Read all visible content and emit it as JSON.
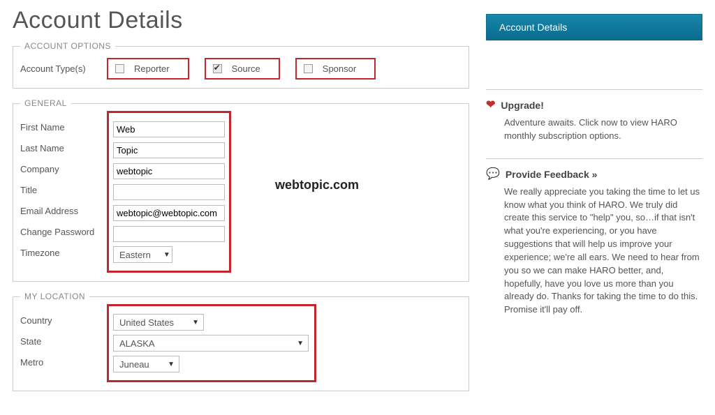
{
  "title": "Account Details",
  "sidebar_tab": "Account Details",
  "account_options": {
    "legend": "ACCOUNT OPTIONS",
    "label": "Account Type(s)",
    "types": [
      {
        "label": "Reporter",
        "checked": false
      },
      {
        "label": "Source",
        "checked": true
      },
      {
        "label": "Sponsor",
        "checked": false
      }
    ]
  },
  "general": {
    "legend": "GENERAL",
    "first_name_label": "First Name",
    "first_name": "Web",
    "last_name_label": "Last Name",
    "last_name": "Topic",
    "company_label": "Company",
    "company": "webtopic",
    "title_label": "Title",
    "title_value": "",
    "email_label": "Email Address",
    "email": "webtopic@webtopic.com",
    "change_password_label": "Change Password",
    "change_password": "",
    "timezone_label": "Timezone",
    "timezone": "Eastern",
    "watermark": "webtopic.com"
  },
  "location": {
    "legend": "MY LOCATION",
    "country_label": "Country",
    "country": "United States",
    "state_label": "State",
    "state": "ALASKA",
    "metro_label": "Metro",
    "metro": "Juneau"
  },
  "upgrade": {
    "heading": "Upgrade!",
    "body": "Adventure awaits. Click now to view HARO monthly subscription options."
  },
  "feedback": {
    "heading": "Provide Feedback »",
    "body": "We really appreciate you taking the time to let us know what you think of HARO. We truly did create this service to \"help\" you, so…if that isn't what you're experiencing, or you have suggestions that will help us improve your experience; we're all ears. We need to hear from you so we can make HARO better, and, hopefully, have you love us more than you already do. Thanks for taking the time to do this. Promise it'll pay off."
  }
}
